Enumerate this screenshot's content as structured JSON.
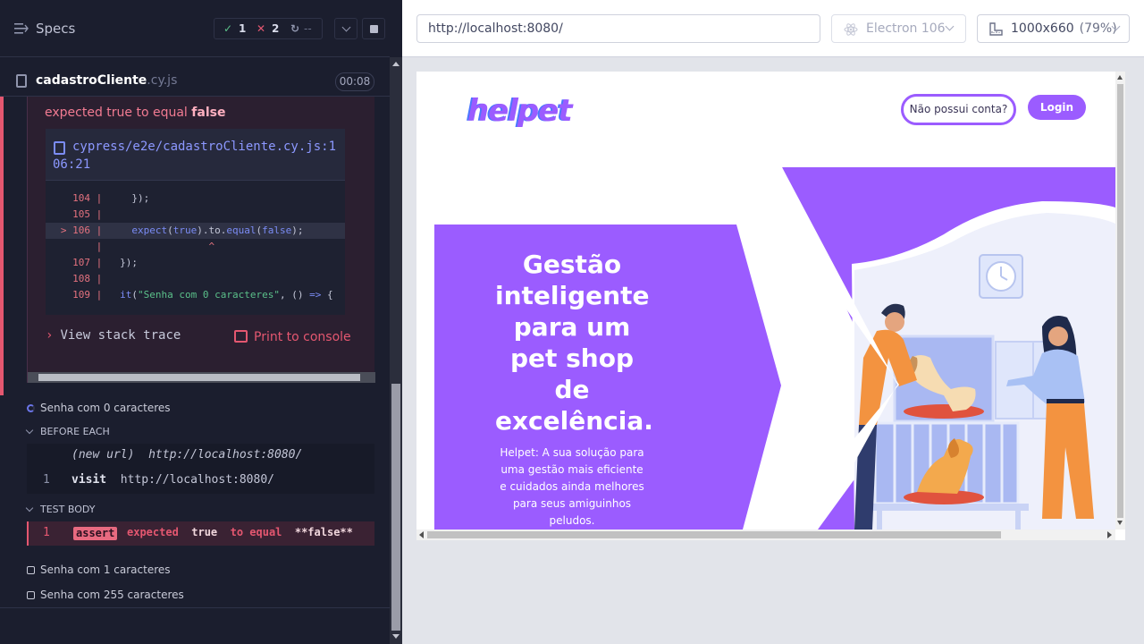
{
  "runner": {
    "specs_label": "Specs",
    "stats": {
      "passed": "1",
      "failed": "2",
      "pending": "--"
    },
    "spec": {
      "name": "cadastroCliente",
      "ext": ".cy.js",
      "duration": "00:08"
    }
  },
  "error": {
    "message_prefix": "expected true to equal ",
    "message_value": "false",
    "file_path": "cypress/e2e/cadastroCliente.cy.js:106:21",
    "code_lines": [
      {
        "num": "104",
        "marker": "",
        "code": "    });"
      },
      {
        "num": "105",
        "marker": "",
        "code": ""
      },
      {
        "num": "106",
        "marker": ">",
        "code": "    expect(true).to.equal(false);"
      },
      {
        "num": "",
        "marker": "",
        "code": "                 ^"
      },
      {
        "num": "107",
        "marker": "",
        "code": "  });"
      },
      {
        "num": "108",
        "marker": "",
        "code": ""
      },
      {
        "num": "109",
        "marker": "",
        "code": "  it(\"Senha com 0 caracteres\", () => {"
      }
    ],
    "view_stack_trace": "View stack trace",
    "print_to_console": "Print to console"
  },
  "tests": {
    "current": "Senha com 0 caracteres",
    "before_each_title": "BEFORE EACH",
    "before_each_cmds": [
      {
        "num": "",
        "name": "(new url)",
        "arg": "http://localhost:8080/"
      },
      {
        "num": "1",
        "name": "visit",
        "arg": "http://localhost:8080/"
      }
    ],
    "test_body_title": "TEST BODY",
    "assert": {
      "num": "1",
      "badge": "assert",
      "text_expected": "expected",
      "text_true": "true",
      "text_to_equal": "to equal",
      "text_false": "**false**"
    },
    "others": [
      "Senha com 1 caracteres",
      "Senha com 255 caracteres"
    ]
  },
  "browser": {
    "url": "http://localhost:8080/",
    "browser_name": "Electron 106",
    "viewport": "1000x660",
    "zoom": "(79%)"
  },
  "app": {
    "logo": "helpet",
    "btn_no_account": "Não possui conta?",
    "btn_login": "Login",
    "hero_title": "Gestão inteligente para um pet shop de excelência.",
    "hero_subtitle": "Helpet: A sua solução para uma gestão mais eficiente e cuidados ainda melhores para seus amiguinhos peludos.",
    "brand_color": "#9b5cff"
  }
}
